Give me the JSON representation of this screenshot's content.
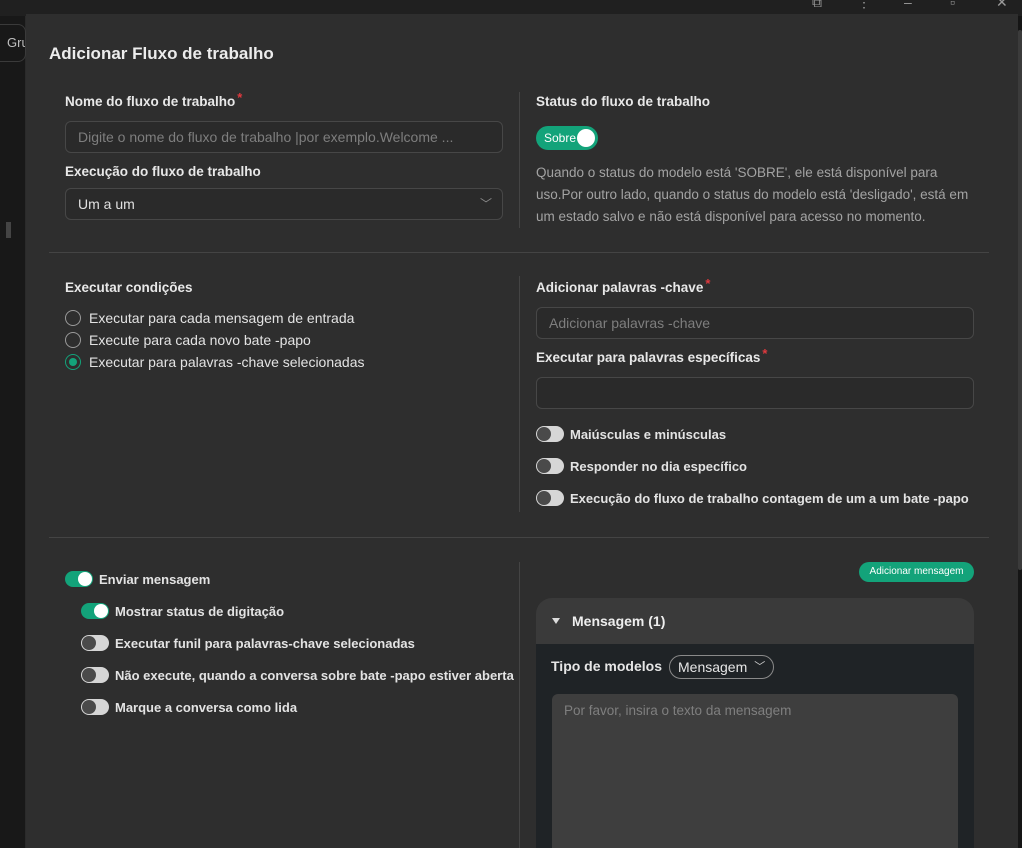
{
  "background": {
    "tab_label": "Gru"
  },
  "modal": {
    "title": "Adicionar Fluxo de trabalho",
    "workflow_name": {
      "label": "Nome do fluxo de trabalho",
      "required_mark": "*",
      "placeholder": "Digite o nome do fluxo de trabalho |por exemplo.Welcome ..."
    },
    "execution": {
      "label": "Execução do fluxo de trabalho",
      "value": "Um a um"
    },
    "status": {
      "label": "Status do fluxo de trabalho",
      "toggle_text": "Sobre",
      "toggle_on": true,
      "description": "Quando o status do modelo está 'SOBRE', ele está disponível para uso.Por outro lado, quando o status do modelo está 'desligado', está em um estado salvo e não está disponível para acesso no momento."
    },
    "conditions": {
      "label": "Executar condições",
      "options": [
        {
          "label": "Executar para cada mensagem de entrada",
          "selected": false
        },
        {
          "label": "Execute para cada novo bate -papo",
          "selected": false
        },
        {
          "label": "Executar para palavras -chave selecionadas",
          "selected": true
        }
      ]
    },
    "keywords": {
      "label": "Adicionar palavras -chave",
      "required_mark": "*",
      "placeholder": "Adicionar palavras -chave",
      "specific_label": "Executar para palavras específicas",
      "specific_required_mark": "*",
      "specific_value": "",
      "switches": [
        {
          "label": "Maiúsculas e minúsculas",
          "on": false
        },
        {
          "label": "Responder no dia específico",
          "on": false
        },
        {
          "label": "Execução do fluxo de trabalho contagem de um a um bate -papo",
          "on": false
        }
      ]
    },
    "send": {
      "main": {
        "label": "Enviar mensagem",
        "on": true
      },
      "options": [
        {
          "label": "Mostrar status de digitação",
          "on": true
        },
        {
          "label": "Executar funil para palavras-chave selecionadas",
          "on": false
        },
        {
          "label": "Não execute, quando a conversa sobre bate -papo estiver aberta",
          "on": false
        },
        {
          "label": "Marque a conversa como lida",
          "on": false
        }
      ]
    },
    "messages": {
      "add_button": "Adicionar mensagem",
      "panel_title": "Mensagem (1)",
      "type_label": "Tipo de modelos",
      "type_value": "Mensagem",
      "text_placeholder": "Por favor, insira o texto da mensagem"
    }
  },
  "colors": {
    "accent": "#13a37a",
    "required": "#e0393e",
    "modal_bg": "#2e2e2e"
  }
}
